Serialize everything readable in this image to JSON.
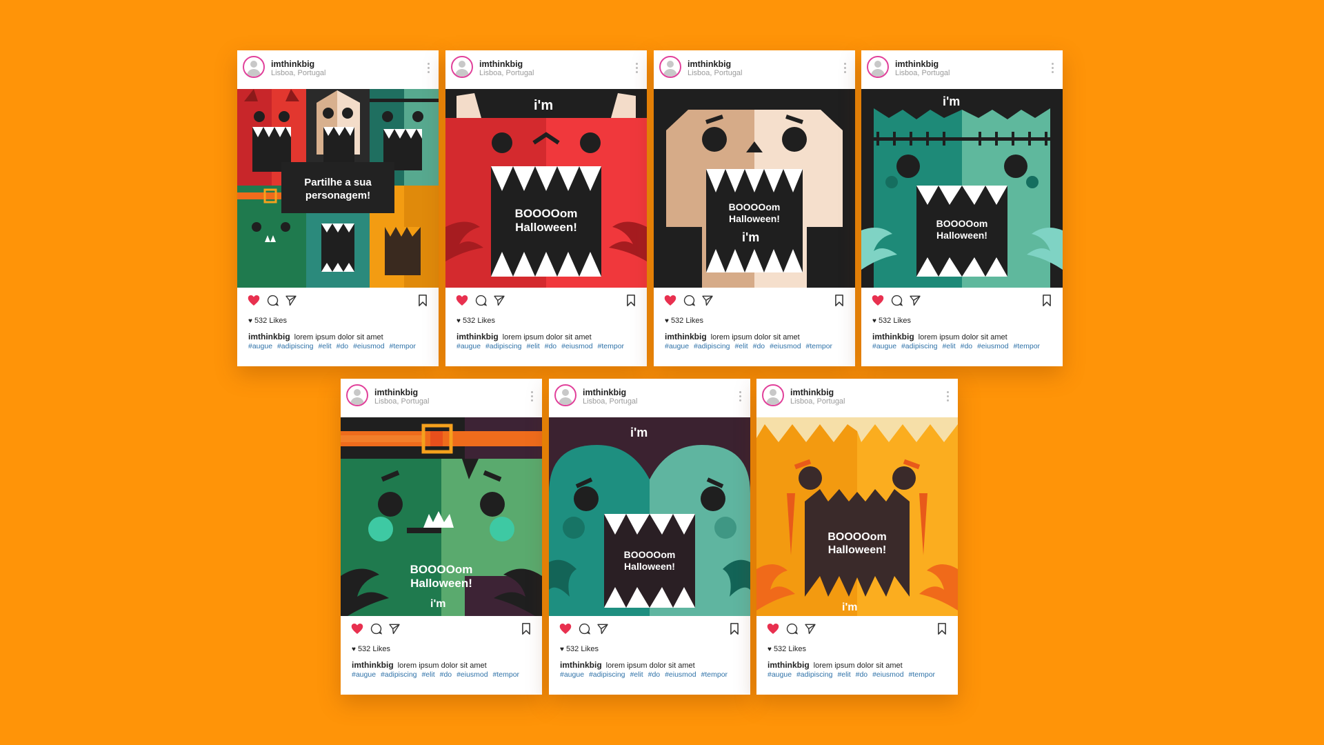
{
  "post": {
    "username": "imthinkbig",
    "location": "Lisboa, Portugal",
    "likes": "532 Likes",
    "caption": "lorem ipsum dolor sit amet",
    "tags": [
      "#augue",
      "#adipiscing",
      "#elit",
      "#do",
      "#eiusmod",
      "#tempor"
    ]
  },
  "artwork": {
    "share_text_line1": "Partilhe a sua",
    "share_text_line2": "personagem!",
    "greeting_line1": "BOOOOom",
    "greeting_line2": "Halloween!",
    "logo_text": "i'm"
  },
  "icons": [
    "heart-icon",
    "comment-icon",
    "send-icon",
    "bookmark-icon",
    "more-icon",
    "avatar-icon"
  ],
  "colors": {
    "background": "#FF9408",
    "heart": "#e8304f",
    "avatar_ring": "#e1409a",
    "tag_link": "#2f72a8"
  }
}
